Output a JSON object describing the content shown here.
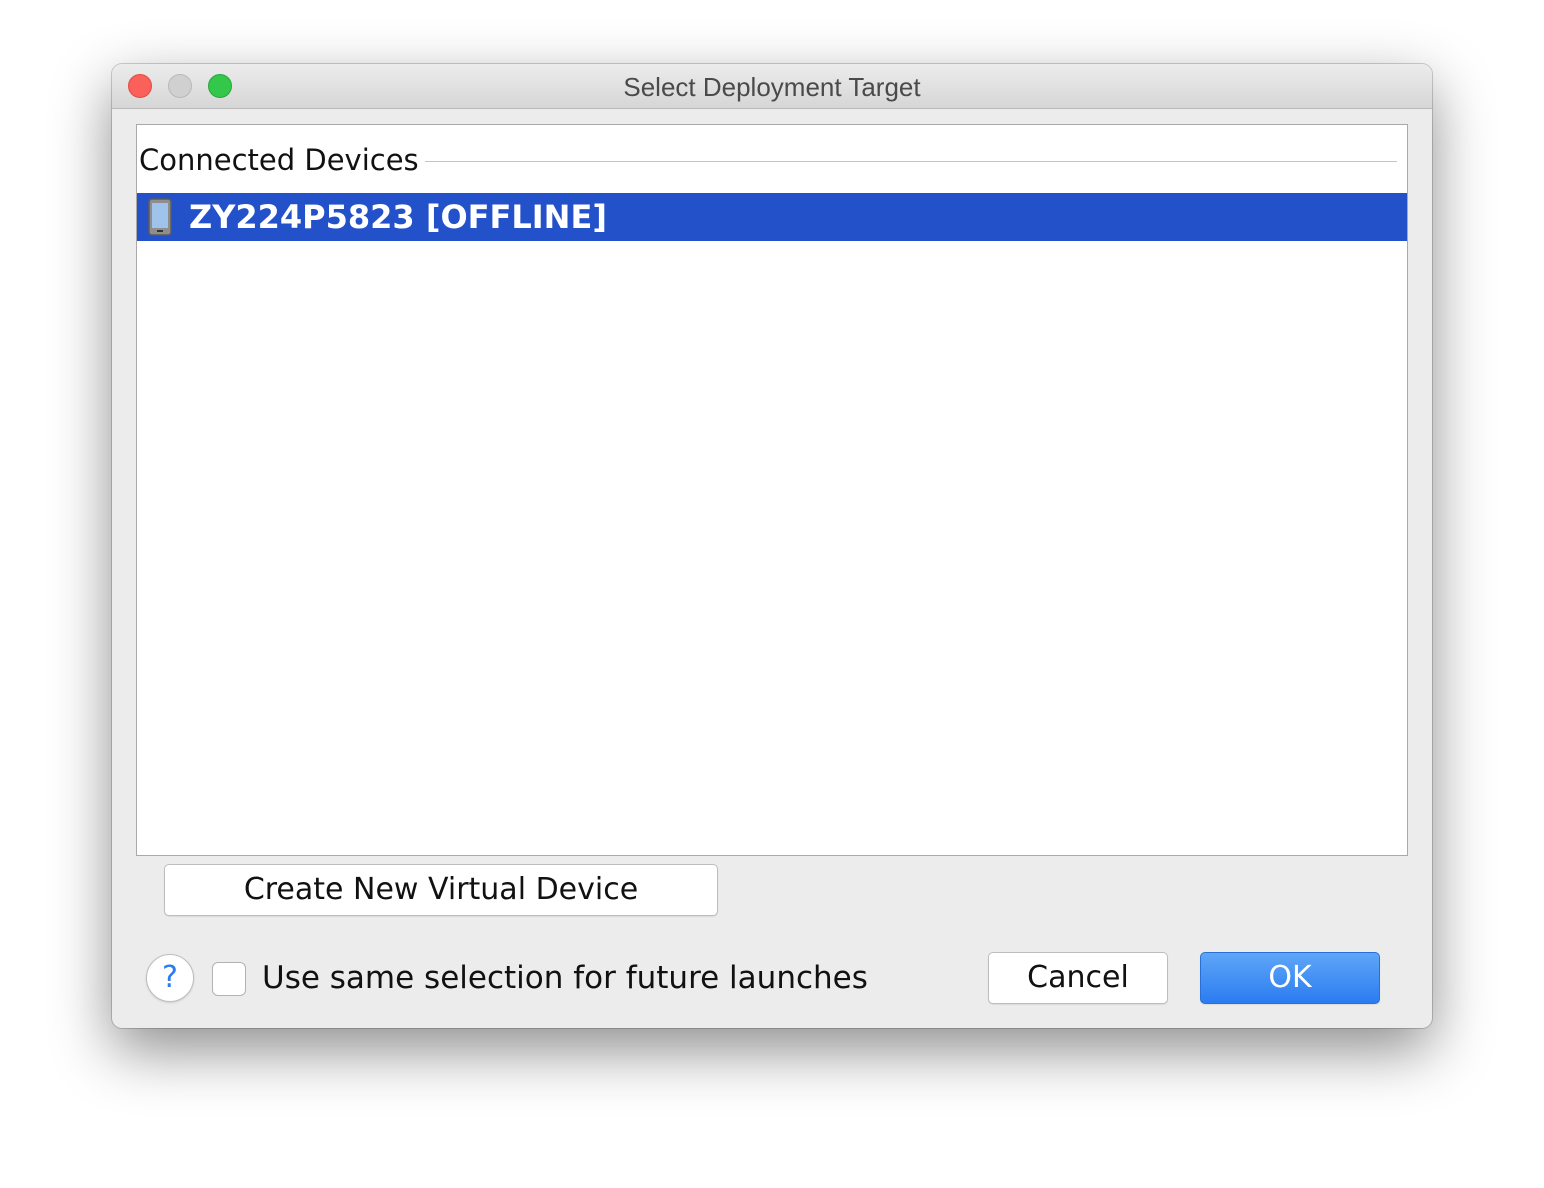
{
  "window": {
    "title": "Select Deployment Target"
  },
  "device_list": {
    "section_title": "Connected Devices",
    "devices": [
      {
        "label": "ZY224P5823 [OFFLINE]",
        "icon": "phone-icon",
        "selected": true
      }
    ],
    "selection_color": "#2351c9"
  },
  "actions": {
    "create_label": "Create New Virtual Device",
    "help_label": "?",
    "remember_label": "Use same selection for future launches",
    "remember_checked": false,
    "cancel_label": "Cancel",
    "ok_label": "OK"
  },
  "colors": {
    "accent": "#2b7cf0",
    "close": "#fc605b",
    "minimize": "#d0d0d0",
    "zoom": "#34c84a"
  }
}
